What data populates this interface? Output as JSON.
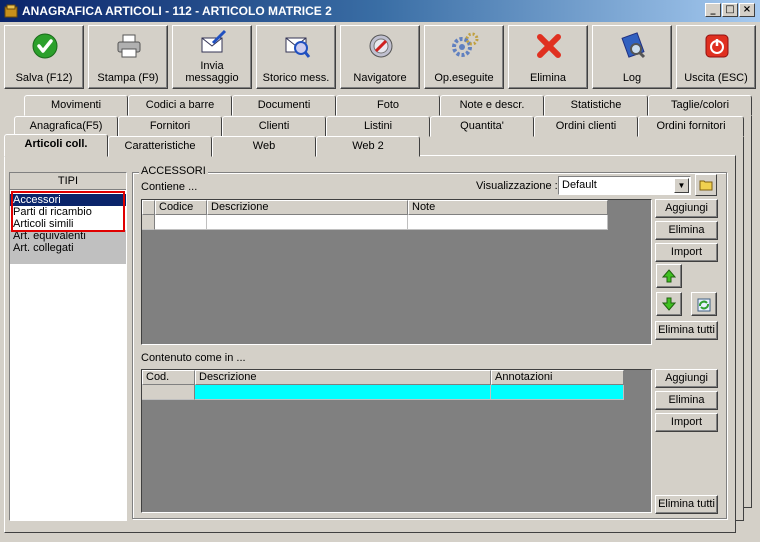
{
  "window": {
    "title": "ANAGRAFICA ARTICOLI - 112 - ARTICOLO MATRICE 2",
    "minimize": "_",
    "maximize": "□",
    "close": "×"
  },
  "toolbar": {
    "buttons": [
      {
        "label": "Salva (F12)",
        "icon": "check-icon",
        "color": "#2ca02c"
      },
      {
        "label": "Stampa (F9)",
        "icon": "printer-icon"
      },
      {
        "label": "Invia messaggio",
        "line1": "Invia",
        "line2": "messaggio",
        "icon": "send-message-icon"
      },
      {
        "label": "Storico mess.",
        "icon": "message-history-icon"
      },
      {
        "label": "Navigatore",
        "icon": "navigator-icon"
      },
      {
        "label": "Op.eseguite",
        "icon": "operations-icon"
      },
      {
        "label": "Elimina",
        "icon": "delete-icon",
        "color": "#e03020"
      },
      {
        "label": "Log",
        "icon": "log-icon"
      },
      {
        "label": "Uscita (ESC)",
        "icon": "exit-icon",
        "color": "#e03020"
      }
    ]
  },
  "tabs": {
    "row1": [
      "Movimenti",
      "Codici a barre",
      "Documenti",
      "Foto",
      "Note e descr.",
      "Statistiche",
      "Taglie/colori"
    ],
    "row2": [
      "Anagrafica(F5)",
      "Fornitori",
      "Clienti",
      "Listini",
      "Quantita'",
      "Ordini clienti",
      "Ordini fornitori"
    ],
    "row3": [
      "Articoli coll.",
      "Caratteristiche",
      "Web",
      "Web 2"
    ],
    "active": "Articoli coll."
  },
  "tipi": {
    "header": "TIPI",
    "items": [
      "Accessori",
      "Parti di ricambio",
      "Articoli simili",
      "Art. equivalenti",
      "Art. collegati"
    ],
    "selected": "Accessori"
  },
  "accessori": {
    "group_title": "ACCESSORI",
    "contiene_label": "Contiene ...",
    "visualizzazione_label": "Visualizzazione :",
    "visualizzazione_value": "Default",
    "top_grid": {
      "columns": [
        "Codice",
        "Descrizione",
        "Note"
      ]
    },
    "top_buttons": {
      "aggiungi": "Aggiungi",
      "elimina": "Elimina",
      "import": "Import",
      "elimina_tutti": "Elimina tutti"
    },
    "contenuto_label": "Contenuto come  in ...",
    "bottom_grid": {
      "columns": [
        "Cod.",
        "Descrizione",
        "Annotazioni"
      ],
      "highlight_color": "#00ffff"
    },
    "bottom_buttons": {
      "aggiungi": "Aggiungi",
      "elimina": "Elimina",
      "import": "Import",
      "elimina_tutti": "Elimina tutti"
    }
  }
}
